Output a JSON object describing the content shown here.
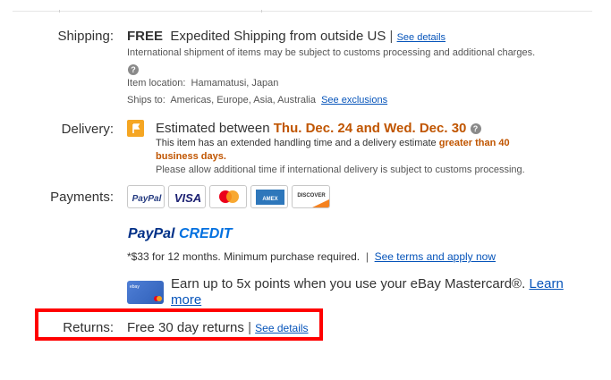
{
  "shipping": {
    "label": "Shipping:",
    "free": "FREE",
    "method": "Expedited Shipping from outside US",
    "separator": "|",
    "see_details": "See details",
    "note": "International shipment of items may be subject to customs processing and additional charges.",
    "item_location_label": "Item location:",
    "item_location": "Hamamatusi, Japan",
    "ships_to_label": "Ships to:",
    "ships_to": "Americas, Europe, Asia, Australia",
    "see_exclusions": "See exclusions"
  },
  "delivery": {
    "label": "Delivery:",
    "estimated_prefix": "Estimated between",
    "dates": "Thu. Dec. 24 and Wed. Dec. 30",
    "handling_prefix": "This item has an extended handling time and a delivery estimate",
    "handling_highlight_1": "greater than 40",
    "handling_highlight_2": "business days.",
    "allow_time": "Please allow additional time if international delivery is subject to customs processing."
  },
  "payments": {
    "label": "Payments:",
    "cards": [
      "PayPal",
      "VISA",
      "Mastercard",
      "American Express",
      "DISCOVER"
    ],
    "paypal_credit_paypal": "PayPal",
    "paypal_credit_credit": "CREDIT",
    "credit_terms": "*$33 for 12 months. Minimum purchase required.",
    "separator": "|",
    "credit_link": "See terms and apply now",
    "ebay_card_line1": "Earn up to 5x points when you use your eBay Mastercard®.",
    "learn": "Learn",
    "more": "more"
  },
  "returns": {
    "label": "Returns:",
    "text": "Free 30 day returns",
    "separator": "|",
    "see_details": "See details"
  },
  "colors": {
    "link": "#0654ba",
    "highlight_orange": "#c05500",
    "annotation_red": "#ff0000"
  }
}
